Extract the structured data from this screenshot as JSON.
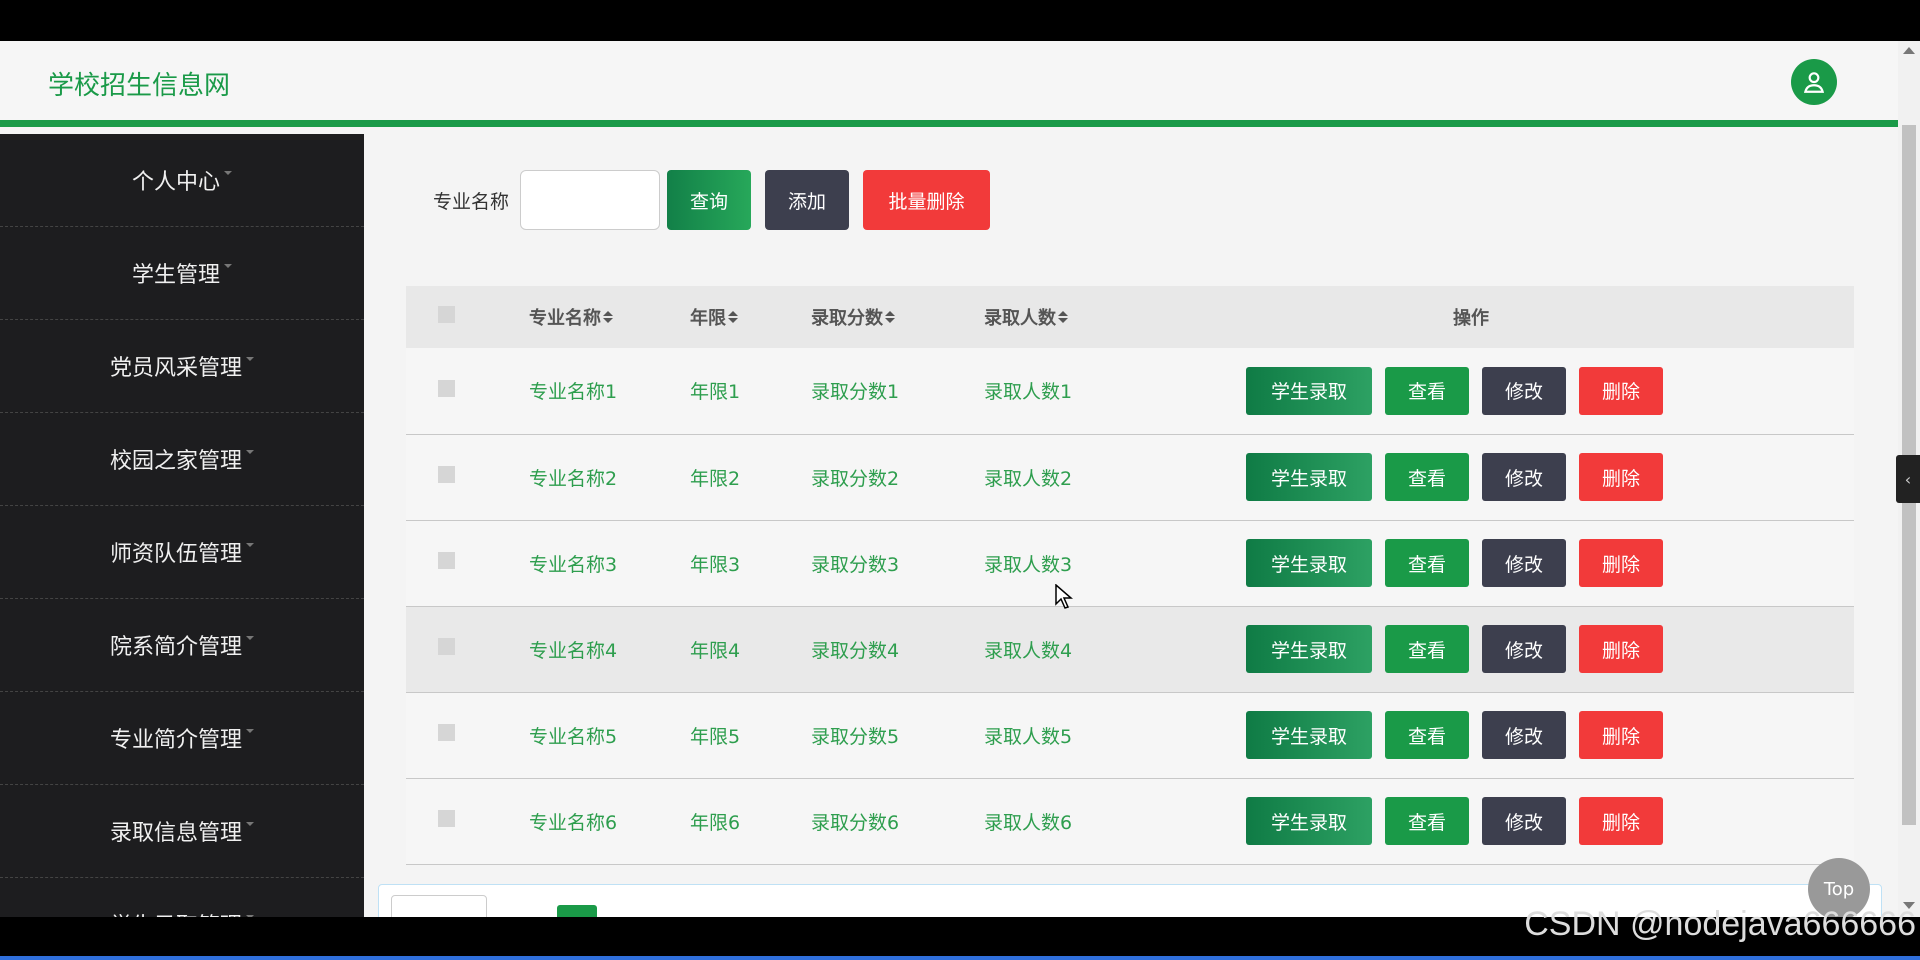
{
  "header": {
    "logo": "学校招生信息网"
  },
  "sidebar": {
    "items": [
      {
        "label": "个人中心"
      },
      {
        "label": "学生管理"
      },
      {
        "label": "党员风采管理"
      },
      {
        "label": "校园之家管理"
      },
      {
        "label": "师资队伍管理"
      },
      {
        "label": "院系简介管理"
      },
      {
        "label": "专业简介管理"
      },
      {
        "label": "录取信息管理"
      },
      {
        "label": "学生录取管理"
      }
    ]
  },
  "search": {
    "label": "专业名称",
    "value": "",
    "query_label": "查询",
    "add_label": "添加",
    "batch_delete_label": "批量删除"
  },
  "table": {
    "columns": [
      "专业名称",
      "年限",
      "录取分数",
      "录取人数",
      "操作"
    ],
    "rows": [
      {
        "name": "专业名称1",
        "years": "年限1",
        "score": "录取分数1",
        "count": "录取人数1"
      },
      {
        "name": "专业名称2",
        "years": "年限2",
        "score": "录取分数2",
        "count": "录取人数2"
      },
      {
        "name": "专业名称3",
        "years": "年限3",
        "score": "录取分数3",
        "count": "录取人数3"
      },
      {
        "name": "专业名称4",
        "years": "年限4",
        "score": "录取分数4",
        "count": "录取人数4"
      },
      {
        "name": "专业名称5",
        "years": "年限5",
        "score": "录取分数5",
        "count": "录取人数5"
      },
      {
        "name": "专业名称6",
        "years": "年限6",
        "score": "录取分数6",
        "count": "录取人数6"
      }
    ],
    "actions": {
      "admit": "学生录取",
      "view": "查看",
      "edit": "修改",
      "delete": "删除"
    }
  },
  "top_button": "Top",
  "side_toggle": "‹",
  "watermark": "CSDN @nodejava666666",
  "colors": {
    "brand": "#1a9a48",
    "dark": "#3d3f4e",
    "danger": "#f23a3a",
    "sidebar": "#1d1d1f"
  }
}
